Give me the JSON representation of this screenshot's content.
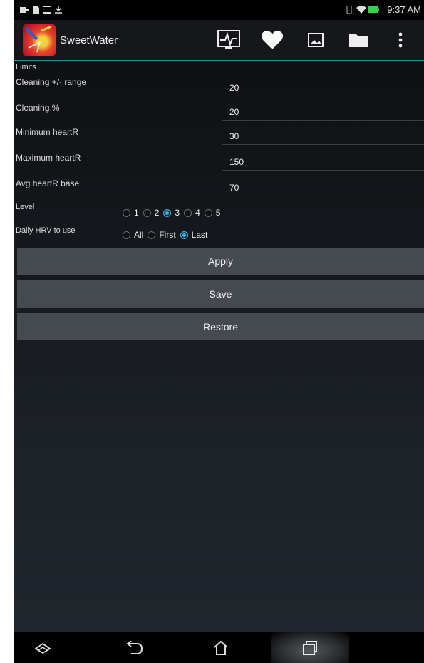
{
  "status_bar": {
    "time": "9:37 AM",
    "left_icons": [
      "battery-charging-icon",
      "sim-icon",
      "image-icon",
      "download-icon"
    ],
    "right_icons": [
      "vibrate-icon",
      "wifi-icon",
      "battery-icon"
    ]
  },
  "action_bar": {
    "app_title": "SweetWater",
    "actions": [
      "ecg-monitor-icon",
      "heart-icon",
      "picture-icon",
      "folder-icon",
      "overflow-menu-icon"
    ]
  },
  "form": {
    "section_label": "Limits",
    "fields": [
      {
        "label": "Cleaning +/- range",
        "value": "20"
      },
      {
        "label": "Cleaning %",
        "value": "20"
      },
      {
        "label": "Minimum heartR",
        "value": "30"
      },
      {
        "label": "Maximum heartR",
        "value": "150"
      },
      {
        "label": "Avg heartR base",
        "value": "70"
      }
    ],
    "level": {
      "label": "Level",
      "options": [
        "1",
        "2",
        "3",
        "4",
        "5"
      ],
      "selected": "3"
    },
    "daily_hrv": {
      "label": "Daily HRV to use",
      "options": [
        "All",
        "First",
        "Last"
      ],
      "selected": "Last"
    }
  },
  "buttons": {
    "apply": "Apply",
    "save": "Save",
    "restore": "Restore"
  },
  "nav_bar": {
    "buttons": [
      "asus-menu-icon",
      "back-icon",
      "home-icon",
      "recent-apps-icon"
    ]
  },
  "colors": {
    "accent": "#38b4e6",
    "actionbar_underline": "#2f86a7",
    "button_bg": "#454a50"
  }
}
